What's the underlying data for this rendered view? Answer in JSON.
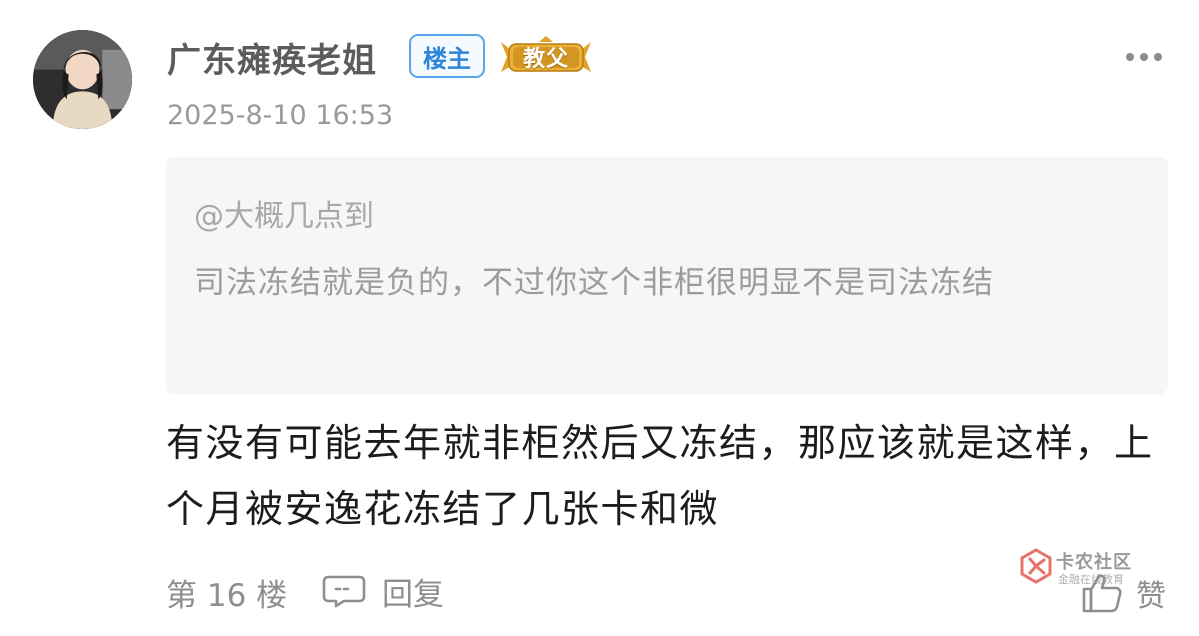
{
  "post": {
    "username": "广东瘫痪老姐",
    "owner_badge": "楼主",
    "rank_badge": "教父",
    "timestamp": "2025-8-10 16:53",
    "quote": {
      "user": "@大概几点到",
      "text": "司法冻结就是负的，不过你这个非柜很明显不是司法冻结"
    },
    "content": "有没有可能去年就非柜然后又冻结，那应该就是这样，上个月被安逸花冻结了几张卡和微",
    "floor": "第 16 楼",
    "reply_label": "回复",
    "like_label": "赞"
  },
  "watermark": {
    "title": "卡农社区",
    "subtitle": "金融在线教育"
  },
  "colors": {
    "owner_badge": "#2f86d8",
    "rank_badge_gold": "#e0a42a",
    "quote_bg": "#f6f6f6",
    "watermark_red": "#e0453a"
  },
  "icons": [
    "more-dots-icon",
    "comment-bubble-icon",
    "thumbs-up-icon",
    "kanong-logo-icon"
  ]
}
